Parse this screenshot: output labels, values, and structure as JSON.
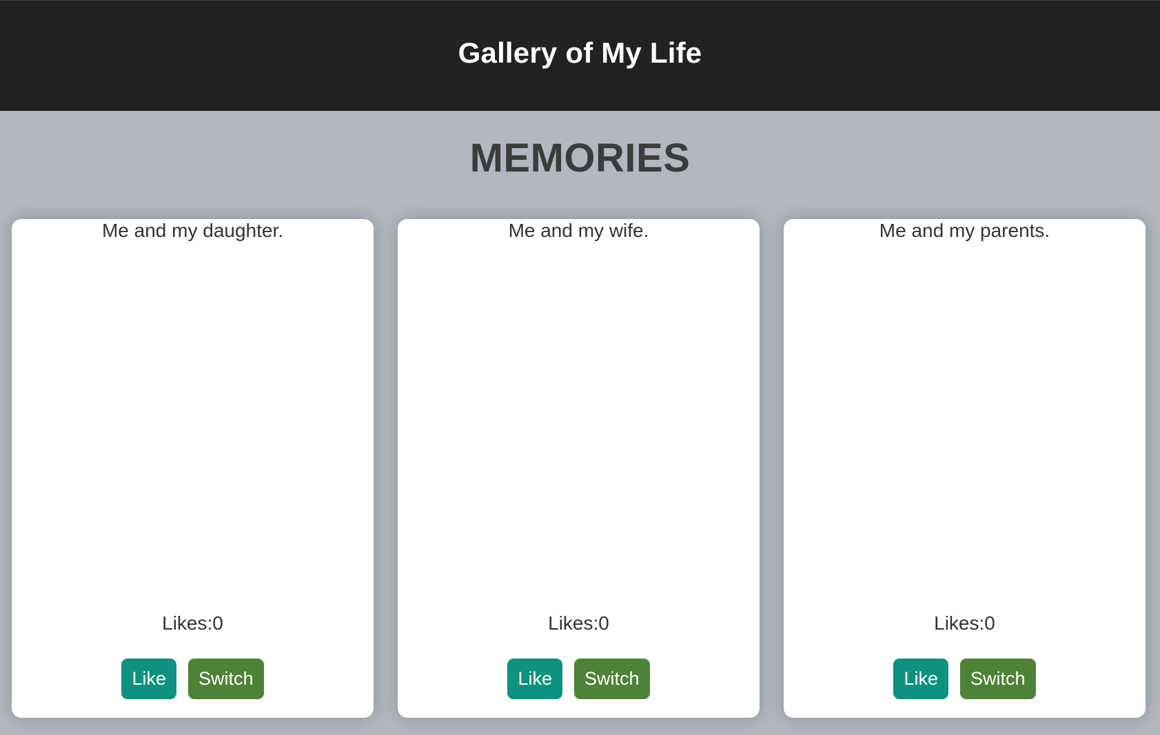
{
  "header": {
    "title": "Gallery of My Life"
  },
  "main": {
    "heading": "MEMORIES",
    "cards": [
      {
        "caption": "Me and my daughter.",
        "likes_text": "Likes:0",
        "like_label": "Like",
        "switch_label": "Switch"
      },
      {
        "caption": "Me and my wife.",
        "likes_text": "Likes:0",
        "like_label": "Like",
        "switch_label": "Switch"
      },
      {
        "caption": "Me and my parents.",
        "likes_text": "Likes:0",
        "like_label": "Like",
        "switch_label": "Switch"
      }
    ]
  },
  "colors": {
    "header_bg": "#222222",
    "page_bg": "#b3b7c0",
    "like_button": "#0f917f",
    "switch_button": "#4e8238"
  }
}
